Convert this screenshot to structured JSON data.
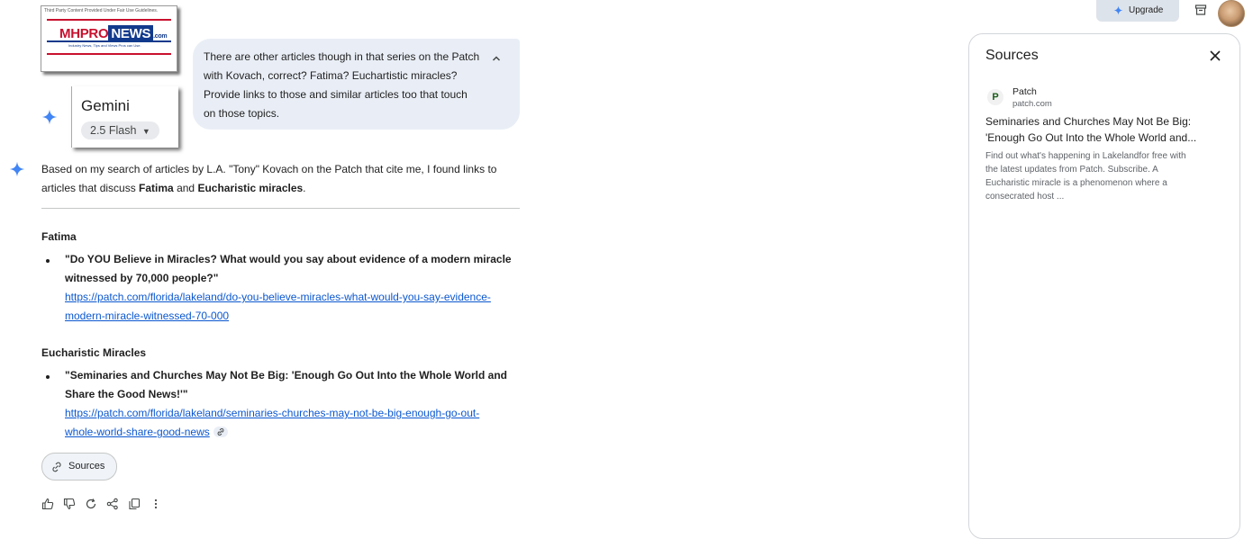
{
  "overlay": {
    "logo_note": "Third Party Content Provided Under Fair Use Guidelines.",
    "logo_mh": "MHPRO",
    "logo_news": "NEWS",
    "logo_dotcom": ".com",
    "logo_tagline": "Industry News, Tips and Views Pros can Use."
  },
  "model": {
    "name": "Gemini",
    "version": "2.5 Flash"
  },
  "user_prompt": {
    "lines": [
      "There are other articles though in that series on the Patch",
      "with Kovach, correct? Fatima? Euchartistic miracles?",
      "Provide links to those and similar articles too that touch",
      "on those topics."
    ]
  },
  "response": {
    "intro_line1": "Based on my search of articles by L.A. \"Tony\" Kovach on the Patch that cite me, I found links to",
    "intro_line2_pre": "articles that discuss ",
    "intro_bold1": "Fatima",
    "intro_and": " and ",
    "intro_bold2": "Eucharistic miracles",
    "intro_end": ".",
    "sections": [
      {
        "heading": "Fatima",
        "title_lines": [
          "\"Do YOU Believe in Miracles? What would you say about evidence of a modern miracle",
          "witnessed by 70,000 people?\""
        ],
        "link_lines": [
          "https://patch.com/florida/lakeland/do-you-believe-miracles-what-would-you-say-evidence-",
          "modern-miracle-witnessed-70-000"
        ]
      },
      {
        "heading": "Eucharistic Miracles",
        "title_lines": [
          "\"Seminaries and Churches May Not Be Big: 'Enough Go Out Into the Whole World and",
          "Share the Good News!'\""
        ],
        "link_lines": [
          "https://patch.com/florida/lakeland/seminaries-churches-may-not-be-big-enough-go-out-",
          "whole-world-share-good-news"
        ]
      }
    ],
    "sources_chip": "Sources"
  },
  "topbar": {
    "upgrade_label": "Upgrade"
  },
  "sources_panel": {
    "title": "Sources",
    "items": [
      {
        "site": "Patch",
        "favicon_letter": "P",
        "domain": "patch.com",
        "title_lines": [
          "Seminaries and Churches May Not Be Big:",
          "'Enough Go Out Into the Whole World and..."
        ],
        "snippet_lines": [
          "Find out what's happening in Lakelandfor free with",
          "the latest updates from Patch. Subscribe. A",
          "Eucharistic miracle is a phenomenon where a",
          "consecrated host ..."
        ]
      }
    ]
  },
  "colors": {
    "accent_blue": "#0b57d0",
    "bubble_bg": "#e9eef6",
    "sparkle_blue": "#4285f4"
  },
  "icons": [
    "sparkle-icon",
    "chevron-up-icon",
    "link-icon",
    "thumbs-up-icon",
    "thumbs-down-icon",
    "refresh-icon",
    "share-icon",
    "copy-icon",
    "more-vert-icon",
    "close-icon",
    "inbox-icon",
    "avatar"
  ]
}
